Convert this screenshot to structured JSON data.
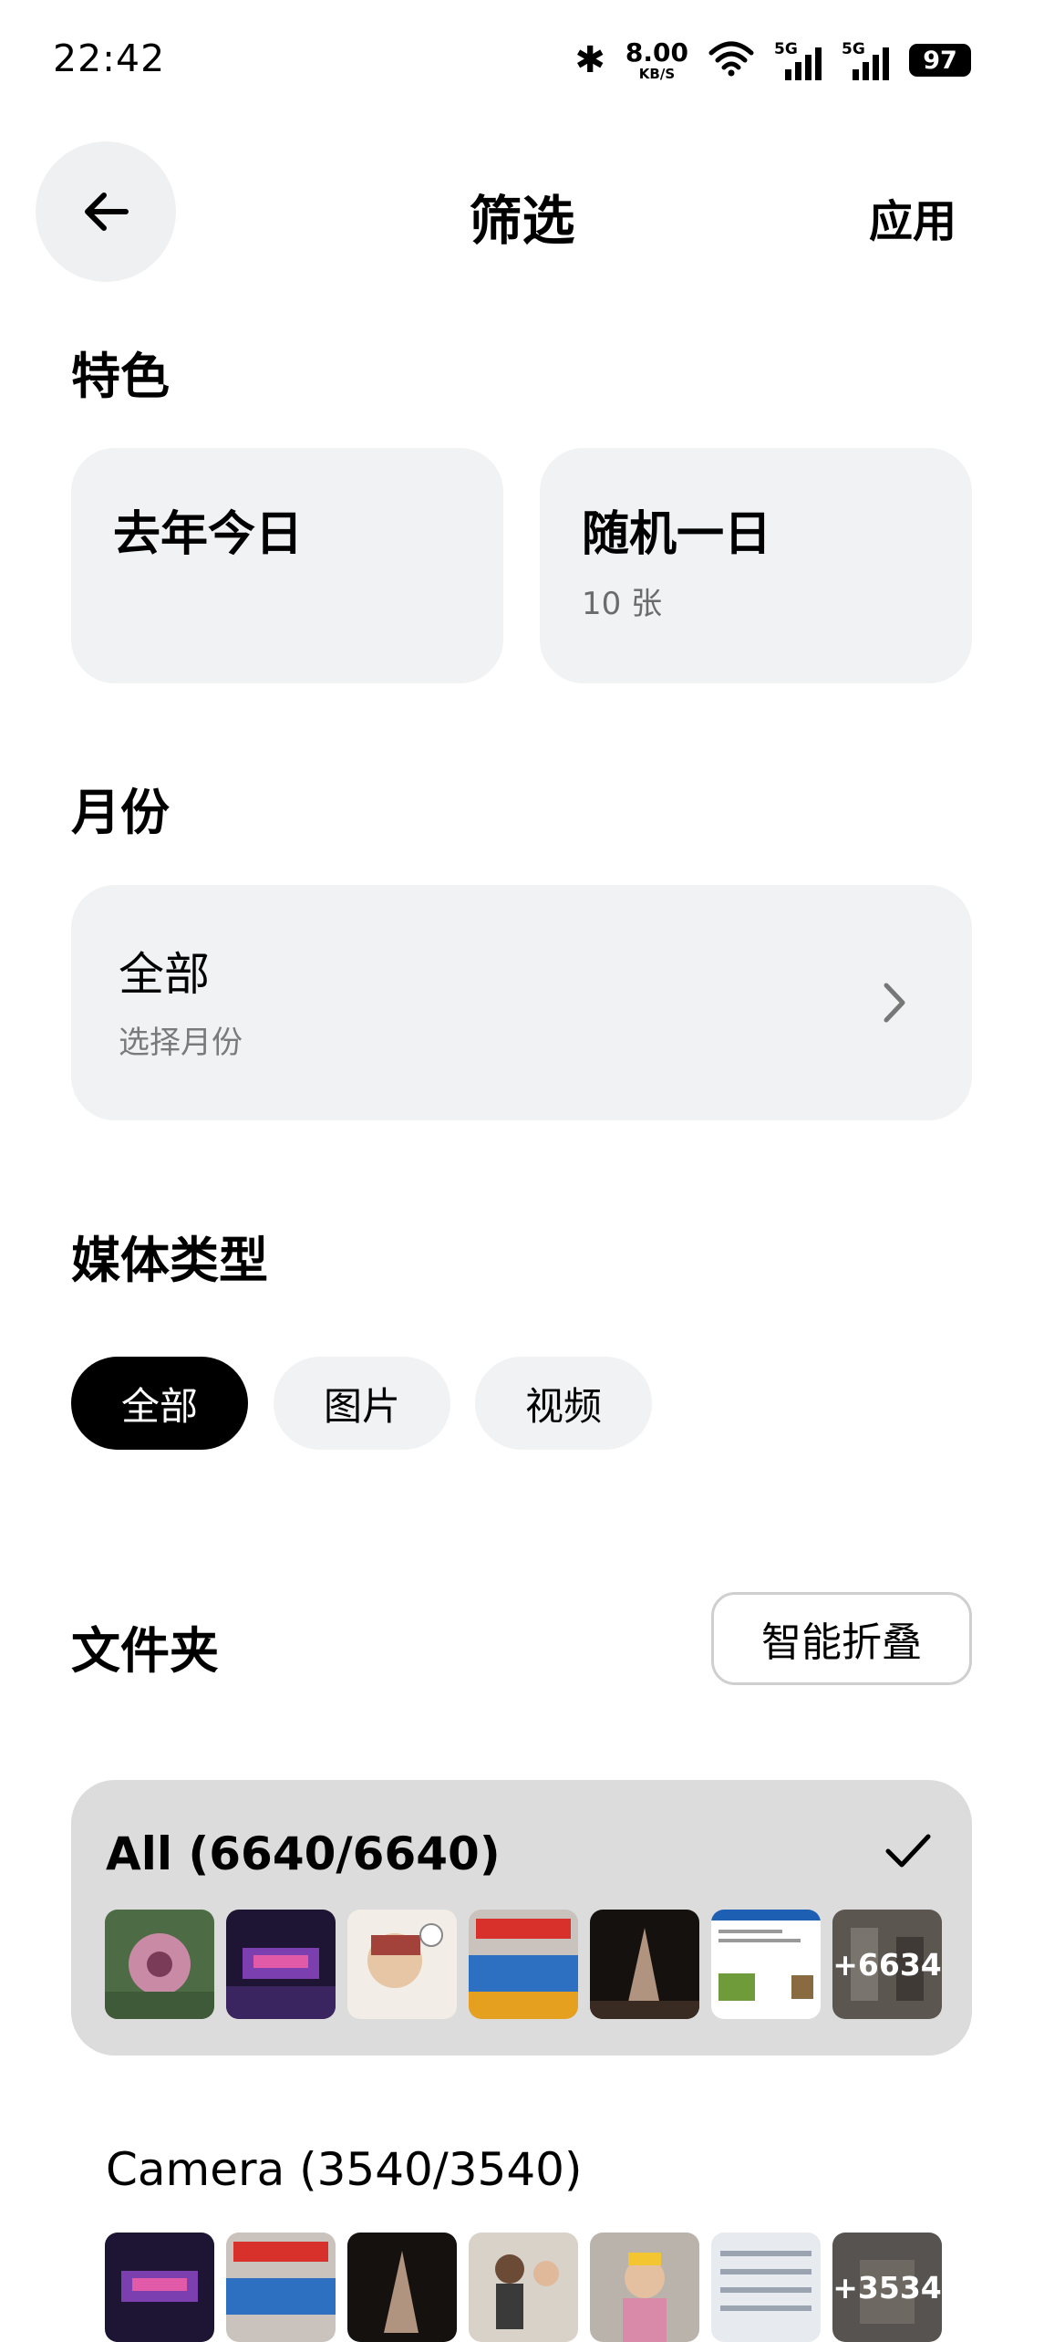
{
  "status_bar": {
    "time": "22:42",
    "net_speed_value": "8.00",
    "net_speed_unit": "KB/S",
    "sim1_type": "5G",
    "sim2_type": "5G",
    "battery": "97",
    "icons": [
      "bluetooth-icon",
      "wifi-icon",
      "signal-icon",
      "battery-icon"
    ]
  },
  "header": {
    "title": "筛选",
    "apply_label": "应用",
    "back_icon": "arrow-left-icon"
  },
  "featured": {
    "heading": "特色",
    "cards": [
      {
        "title": "去年今日",
        "subtitle": ""
      },
      {
        "title": "随机一日",
        "subtitle": "10 张"
      }
    ]
  },
  "month": {
    "heading": "月份",
    "value": "全部",
    "hint": "选择月份",
    "icon": "chevron-right-icon"
  },
  "media_type": {
    "heading": "媒体类型",
    "options": [
      "全部",
      "图片",
      "视频"
    ],
    "selected": "全部"
  },
  "folders": {
    "heading": "文件夹",
    "smart_fold_label": "智能折叠",
    "items": [
      {
        "title": "All (6640/6640)",
        "selected": true,
        "more": "+6634"
      },
      {
        "title": "Camera (3540/3540)",
        "selected": false,
        "more": "+3534"
      }
    ]
  },
  "colors": {
    "card_bg": "#f1f2f4",
    "selected_folder_bg": "#dcdcdc",
    "active_chip": "#000000"
  }
}
